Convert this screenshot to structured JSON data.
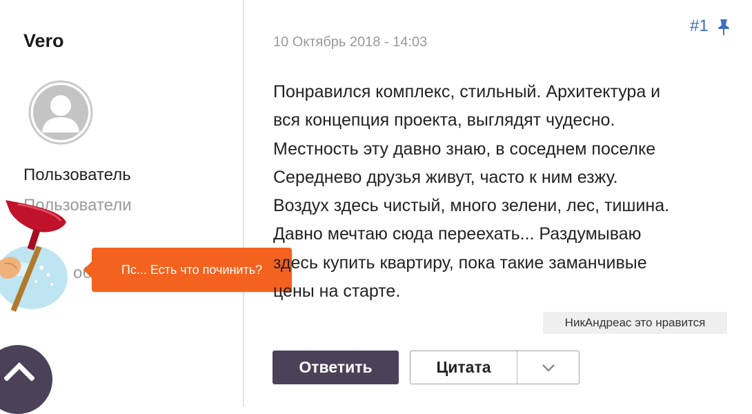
{
  "author": {
    "name": "Vero",
    "title": "Пользователь",
    "group": "Пользователи",
    "stat_fragment": "об"
  },
  "popup": {
    "text": "Пс... Есть что починить?"
  },
  "post": {
    "date": "10 Октябрь 2018 - 14:03",
    "number": "#1",
    "lines": [
      "Понравился комплекс, стильный.  Архитектура и",
      "вся концепция проекта, выглядят чудесно.",
      "Местность эту давно знаю, в соседнем поселке",
      "Середнево друзья живут, часто к ним езжу.",
      "Воздух здесь чистый, много зелени, лес, тишина.",
      "Давно мечтаю сюда переехать... Раздумываю",
      "здесь купить квартиру, пока такие заманчивые",
      "цены на старте."
    ],
    "likes": "НикАндреас это нравится"
  },
  "actions": {
    "reply_label": "Ответить",
    "quote_label": "Цитата"
  },
  "icons": {
    "avatar": "default-avatar-icon",
    "pin": "pin-icon",
    "dropdown": "chevron-down-icon",
    "scroll_top": "chevron-up-icon",
    "mascot": "plunger-mascot-icon"
  },
  "colors": {
    "accent": "#4b4159",
    "link": "#3d6fc0",
    "popup": "#f4621f",
    "muted": "#999999"
  }
}
